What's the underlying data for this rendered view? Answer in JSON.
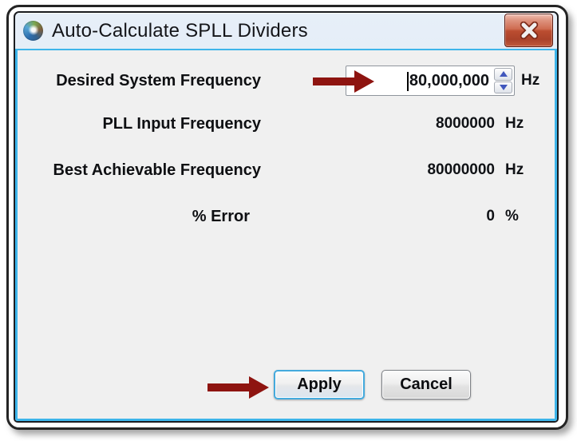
{
  "window": {
    "title": "Auto-Calculate SPLL Dividers"
  },
  "form": {
    "rows": [
      {
        "label": "Desired System Frequency",
        "value": "80,000,000",
        "unit": "Hz"
      },
      {
        "label": "PLL Input Frequency",
        "value": "8000000",
        "unit": "Hz"
      },
      {
        "label": "Best Achievable Frequency",
        "value": "80000000",
        "unit": "Hz"
      },
      {
        "label": "% Error",
        "value": "0",
        "unit": "%"
      }
    ]
  },
  "buttons": {
    "apply": "Apply",
    "cancel": "Cancel"
  },
  "icons": {
    "app": "app-logo-icon",
    "close": "close-x-icon",
    "spinner_up": "spinner-up-icon",
    "spinner_down": "spinner-down-icon",
    "annotations": [
      "red-arrow-pointing-to-frequency-input",
      "red-arrow-pointing-to-apply-button"
    ]
  },
  "colors": {
    "annotation_arrow": "#8e1410",
    "focus_border": "#3db5ea",
    "titlebar_top": "#e7eff8",
    "titlebar_bottom": "#b2c6dc",
    "close_button_red": "#bb4d30",
    "client_background": "#f0f0f0",
    "spinner_arrow_blue": "#4157bd"
  }
}
